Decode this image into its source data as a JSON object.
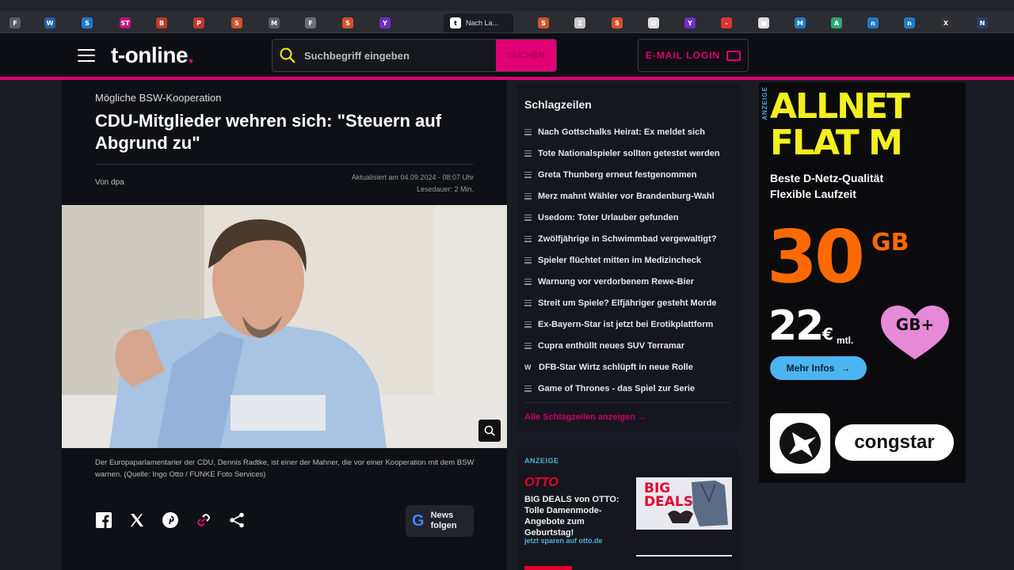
{
  "browser": {
    "active_tab_title": "Nach La...",
    "tab_icons": [
      "F",
      "W",
      "S",
      "ST",
      "B",
      "P",
      "S",
      "M",
      "F",
      "S",
      "Y",
      "t",
      "S",
      "Z",
      "S",
      "O",
      "Y",
      "-",
      "■",
      "M",
      "A",
      "n",
      "n",
      "X",
      "N"
    ]
  },
  "header": {
    "logo_text": "t-online",
    "logo_dot": ".",
    "search_placeholder": "Suchbegriff eingeben",
    "search_button": "SUCHEN",
    "mail_login": "E-MAIL LOGIN",
    "accent": "#e20074"
  },
  "article": {
    "kicker": "Mögliche BSW-Kooperation",
    "headline": "CDU-Mitglieder wehren sich: \"Steuern auf Abgrund zu\"",
    "author": "Von dpa",
    "updated": "Aktualisiert am 04.09.2024 - 08:07 Uhr",
    "reading_time": "Lesedauer: 2 Min.",
    "caption": "Der Europaparlamentarier der CDU, Dennis Radtke, ist einer der Mahner, die vor einer Kooperation mit dem BSW warnen. (Quelle: Ingo Otto / FUNKE Foto Services)",
    "google_news_line1": "News",
    "google_news_line2": "folgen"
  },
  "headlines": {
    "title": "Schlagzeilen",
    "items": [
      {
        "label": "Nach Gottschalks Heirat: Ex meldet sich",
        "icon": "article-icon"
      },
      {
        "label": "Tote Nationalspieler sollten getestet werden",
        "icon": "article-icon"
      },
      {
        "label": "Greta Thunberg erneut festgenommen",
        "icon": "article-icon"
      },
      {
        "label": "Merz mahnt Wähler vor Brandenburg-Wahl",
        "icon": "article-icon"
      },
      {
        "label": "Usedom: Toter Urlauber gefunden",
        "icon": "article-icon"
      },
      {
        "label": "Zwölfjährige in Schwimmbad vergewaltigt?",
        "icon": "article-icon"
      },
      {
        "label": "Spieler flüchtet mitten im Medizincheck",
        "icon": "article-icon"
      },
      {
        "label": "Warnung vor verdorbenem Rewe-Bier",
        "icon": "article-icon"
      },
      {
        "label": "Streit um Spiele? Elfjähriger gesteht Morde",
        "icon": "article-icon"
      },
      {
        "label": "Ex-Bayern-Star ist jetzt bei Erotikplattform",
        "icon": "article-icon"
      },
      {
        "label": "Cupra enthüllt neues SUV Terramar",
        "icon": "article-icon"
      },
      {
        "label": "DFB-Star Wirtz schlüpft in neue Rolle",
        "icon": "w-icon"
      },
      {
        "label": "Game of Thrones - das Spiel zur Serie",
        "icon": "article-icon"
      }
    ],
    "more_link": "Alle Schlagzeilen anzeigen"
  },
  "otto_ad": {
    "label": "ANZEIGE",
    "brand": "OTTO",
    "text": "BIG DEALS von OTTO: Tolle Damenmode-Angebote zum Geburtstag!",
    "link": "jetzt sparen auf otto.de",
    "image_text": "BIG DEALS"
  },
  "congstar_ad": {
    "label": "ANZEIGE",
    "headline_1": "ALLNET",
    "headline_2": "FLAT M",
    "feature_1": "Beste D-Netz-Qualität",
    "feature_2": "Flexible Laufzeit",
    "data_amount": "30",
    "data_unit": "GB",
    "price": "22",
    "currency": "€",
    "per_month": "mtl.",
    "badge": "GB+",
    "cta": "Mehr Infos",
    "brand": "congstar"
  }
}
